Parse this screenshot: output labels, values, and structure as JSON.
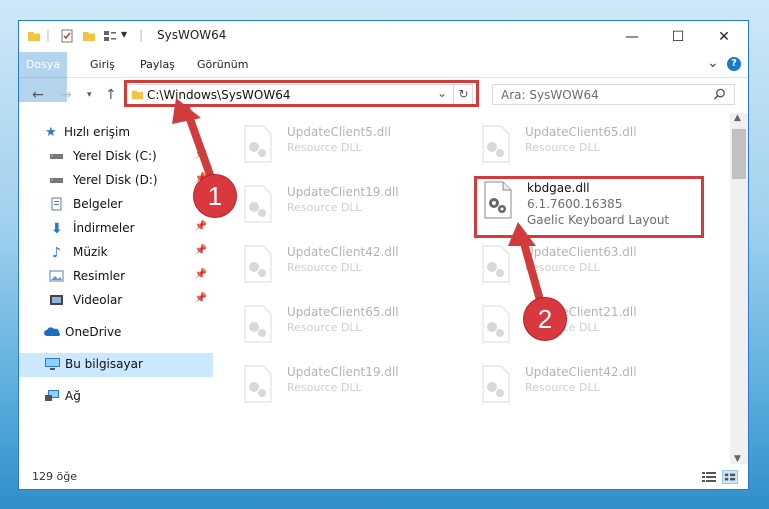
{
  "window": {
    "title": "SysWOW64",
    "minimize_glyph": "—",
    "maximize_glyph": "☐",
    "close_glyph": "✕"
  },
  "ribbon": {
    "tabs": [
      "Dosya",
      "Giriş",
      "Paylaş",
      "Görünüm"
    ],
    "expand_glyph": "⌄",
    "help_glyph": "?"
  },
  "address": {
    "path": "C:\\Windows\\SysWOW64",
    "search_placeholder": "Ara: SysWOW64"
  },
  "sidebar": {
    "quick_access": "Hızlı erişim",
    "items": [
      {
        "label": "Yerel Disk (C:)",
        "icon": "drive-icon",
        "pinned": true
      },
      {
        "label": "Yerel Disk (D:)",
        "icon": "drive-icon",
        "pinned": true
      },
      {
        "label": "Belgeler",
        "icon": "documents-icon",
        "pinned": true
      },
      {
        "label": "İndirmeler",
        "icon": "download-icon",
        "pinned": true
      },
      {
        "label": "Müzik",
        "icon": "music-icon",
        "pinned": true
      },
      {
        "label": "Resimler",
        "icon": "pictures-icon",
        "pinned": true
      },
      {
        "label": "Videolar",
        "icon": "videos-icon",
        "pinned": true
      }
    ],
    "onedrive": "OneDrive",
    "this_pc": "Bu bilgisayar",
    "network": "Ağ"
  },
  "files": {
    "left_column": [
      {
        "name": "UpdateClient5.dll",
        "type": "Resource DLL"
      },
      {
        "name": "UpdateClient19.dll",
        "type": "Resource DLL"
      },
      {
        "name": "UpdateClient42.dll",
        "type": "Resource DLL"
      },
      {
        "name": "UpdateClient65.dll",
        "type": "Resource DLL"
      },
      {
        "name": "UpdateClient19.dll",
        "type": "Resource DLL"
      }
    ],
    "right_column": [
      {
        "name": "UpdateClient65.dll",
        "type": "Resource DLL"
      },
      {
        "name": "UpdateClient63.dll",
        "type": "Resource DLL"
      },
      {
        "name": "UpdateClient21.dll",
        "type": "Resource DLL"
      },
      {
        "name": "UpdateClient42.dll",
        "type": "Resource DLL"
      }
    ],
    "selected": {
      "name": "kbdgae.dll",
      "version": "6.1.7600.16385",
      "description": "Gaelic Keyboard Layout"
    }
  },
  "status": {
    "item_count": "129 öğe"
  },
  "annotations": {
    "step1": "1",
    "step2": "2",
    "color": "#d23b3b"
  }
}
